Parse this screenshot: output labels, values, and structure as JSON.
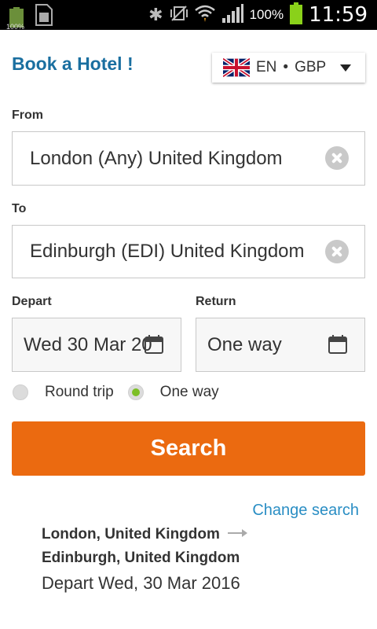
{
  "statusbar": {
    "battery_percent": "100%",
    "time": "11:59",
    "left_badge": "100%"
  },
  "header": {
    "title": "Book a Hotel !",
    "language": "EN",
    "separator": "•",
    "currency": "GBP"
  },
  "form": {
    "from_label": "From",
    "from_value": "London (Any) United Kingdom",
    "to_label": "To",
    "to_value": "Edinburgh (EDI) United Kingdom",
    "depart_label": "Depart",
    "depart_value": "Wed 30 Mar 20",
    "return_label": "Return",
    "return_value": "One way",
    "trip_options": [
      {
        "label": "Round trip",
        "selected": false
      },
      {
        "label": "One way",
        "selected": true
      }
    ],
    "search_label": "Search"
  },
  "summary": {
    "change_search": "Change search",
    "origin": "London, United Kingdom",
    "destination": "Edinburgh, United Kingdom",
    "depart_text": "Depart Wed, 30 Mar 2016"
  },
  "colors": {
    "accent_blue": "#1a6fa0",
    "link_blue": "#2a8ec4",
    "search_orange": "#eb6a10",
    "radio_green": "#7cbf26"
  }
}
